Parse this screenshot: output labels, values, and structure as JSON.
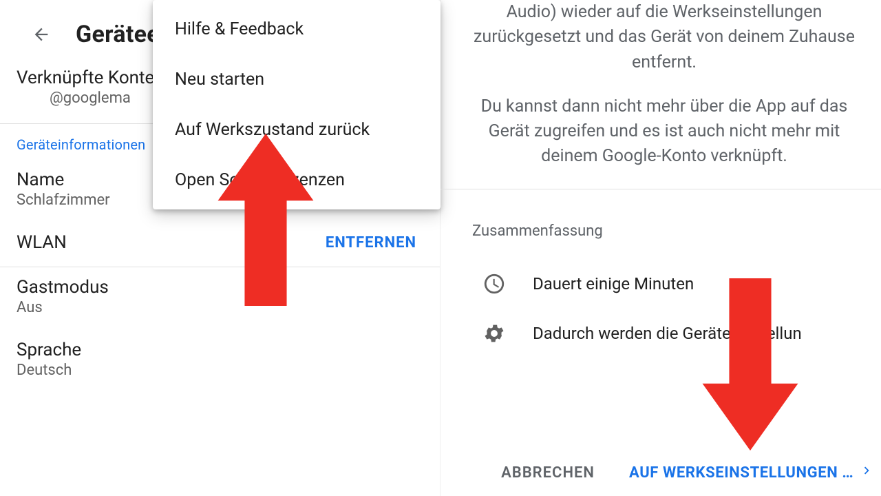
{
  "left": {
    "page_title": "Gerätee",
    "linked_title": "Verknüpfte Konte",
    "linked_sub": "@googlema",
    "section_label": "Geräteinformationen",
    "name_label": "Name",
    "name_value": "Schlafzimmer",
    "wifi_label": "WLAN",
    "wifi_action": "ENTFERNEN",
    "guest_label": "Gastmodus",
    "guest_value": "Aus",
    "language_label": "Sprache",
    "language_value": "Deutsch"
  },
  "menu": {
    "items": [
      "Hilfe & Feedback",
      "Neu starten",
      "Auf Werkszustand zurück",
      "Open Source-Lizenzen"
    ]
  },
  "right": {
    "para1": "Audio) wieder auf die Werkseinstellungen zurückgesetzt und das Gerät von deinem Zuhause entfernt.",
    "para2": "Du kannst dann nicht mehr über die App auf das Gerät zugreifen und es ist auch nicht mehr mit deinem Google-Konto verknüpft.",
    "summary_label": "Zusammenfassung",
    "summary_time": "Dauert einige Minuten",
    "summary_settings": "Dadurch werden die Geräteeinstellun",
    "cancel": "ABBRECHEN",
    "confirm": "AUF WERKSEINSTELLUNGEN …"
  }
}
